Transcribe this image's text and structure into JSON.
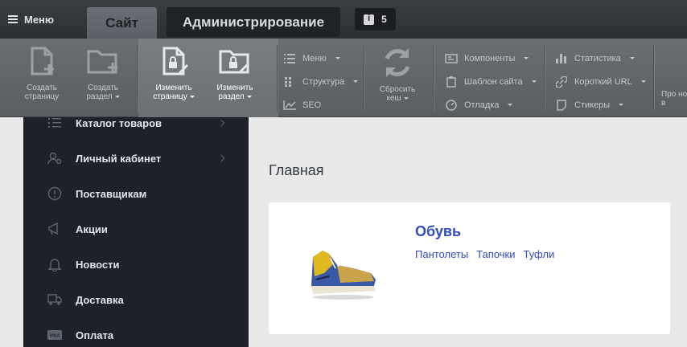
{
  "topbar": {
    "menu_label": "Меню",
    "tab_site": "Сайт",
    "tab_admin": "Администрирование",
    "notifications_count": "5"
  },
  "toolbar": {
    "create_page": "Создать страницу",
    "create_section": "Создать раздел",
    "edit_page": "Изменить страницу",
    "edit_section": "Изменить раздел",
    "menu": "Меню",
    "structure": "Структура",
    "seo": "SEO",
    "reset_cache": "Сбросить кеш",
    "components": "Компоненты",
    "site_template": "Шаблон сайта",
    "debug": "Отладка",
    "statistics": "Статистика",
    "short_url": "Короткий URL",
    "stickers": "Стикеры",
    "cut_off": "Про нов"
  },
  "sidebar": {
    "items": [
      {
        "label": "Каталог товаров",
        "icon": "list-icon",
        "has_arrow": true
      },
      {
        "label": "Личный кабинет",
        "icon": "user-settings-icon",
        "has_arrow": true
      },
      {
        "label": "Поставщикам",
        "icon": "info-circle-icon",
        "has_arrow": false
      },
      {
        "label": "Акции",
        "icon": "megaphone-icon",
        "has_arrow": false
      },
      {
        "label": "Новости",
        "icon": "bell-icon",
        "has_arrow": false
      },
      {
        "label": "Доставка",
        "icon": "truck-icon",
        "has_arrow": false
      },
      {
        "label": "Оплата",
        "icon": "visa-card-icon",
        "has_arrow": false
      }
    ]
  },
  "main": {
    "title": "Главная",
    "category": {
      "title": "Обувь",
      "links": [
        "Пантолеты",
        "Тапочки",
        "Туфли"
      ]
    }
  },
  "colors": {
    "accent_link": "#2f4bbd",
    "sidebar_bg": "#1d2128",
    "toolbar_bg": "#62666b"
  }
}
